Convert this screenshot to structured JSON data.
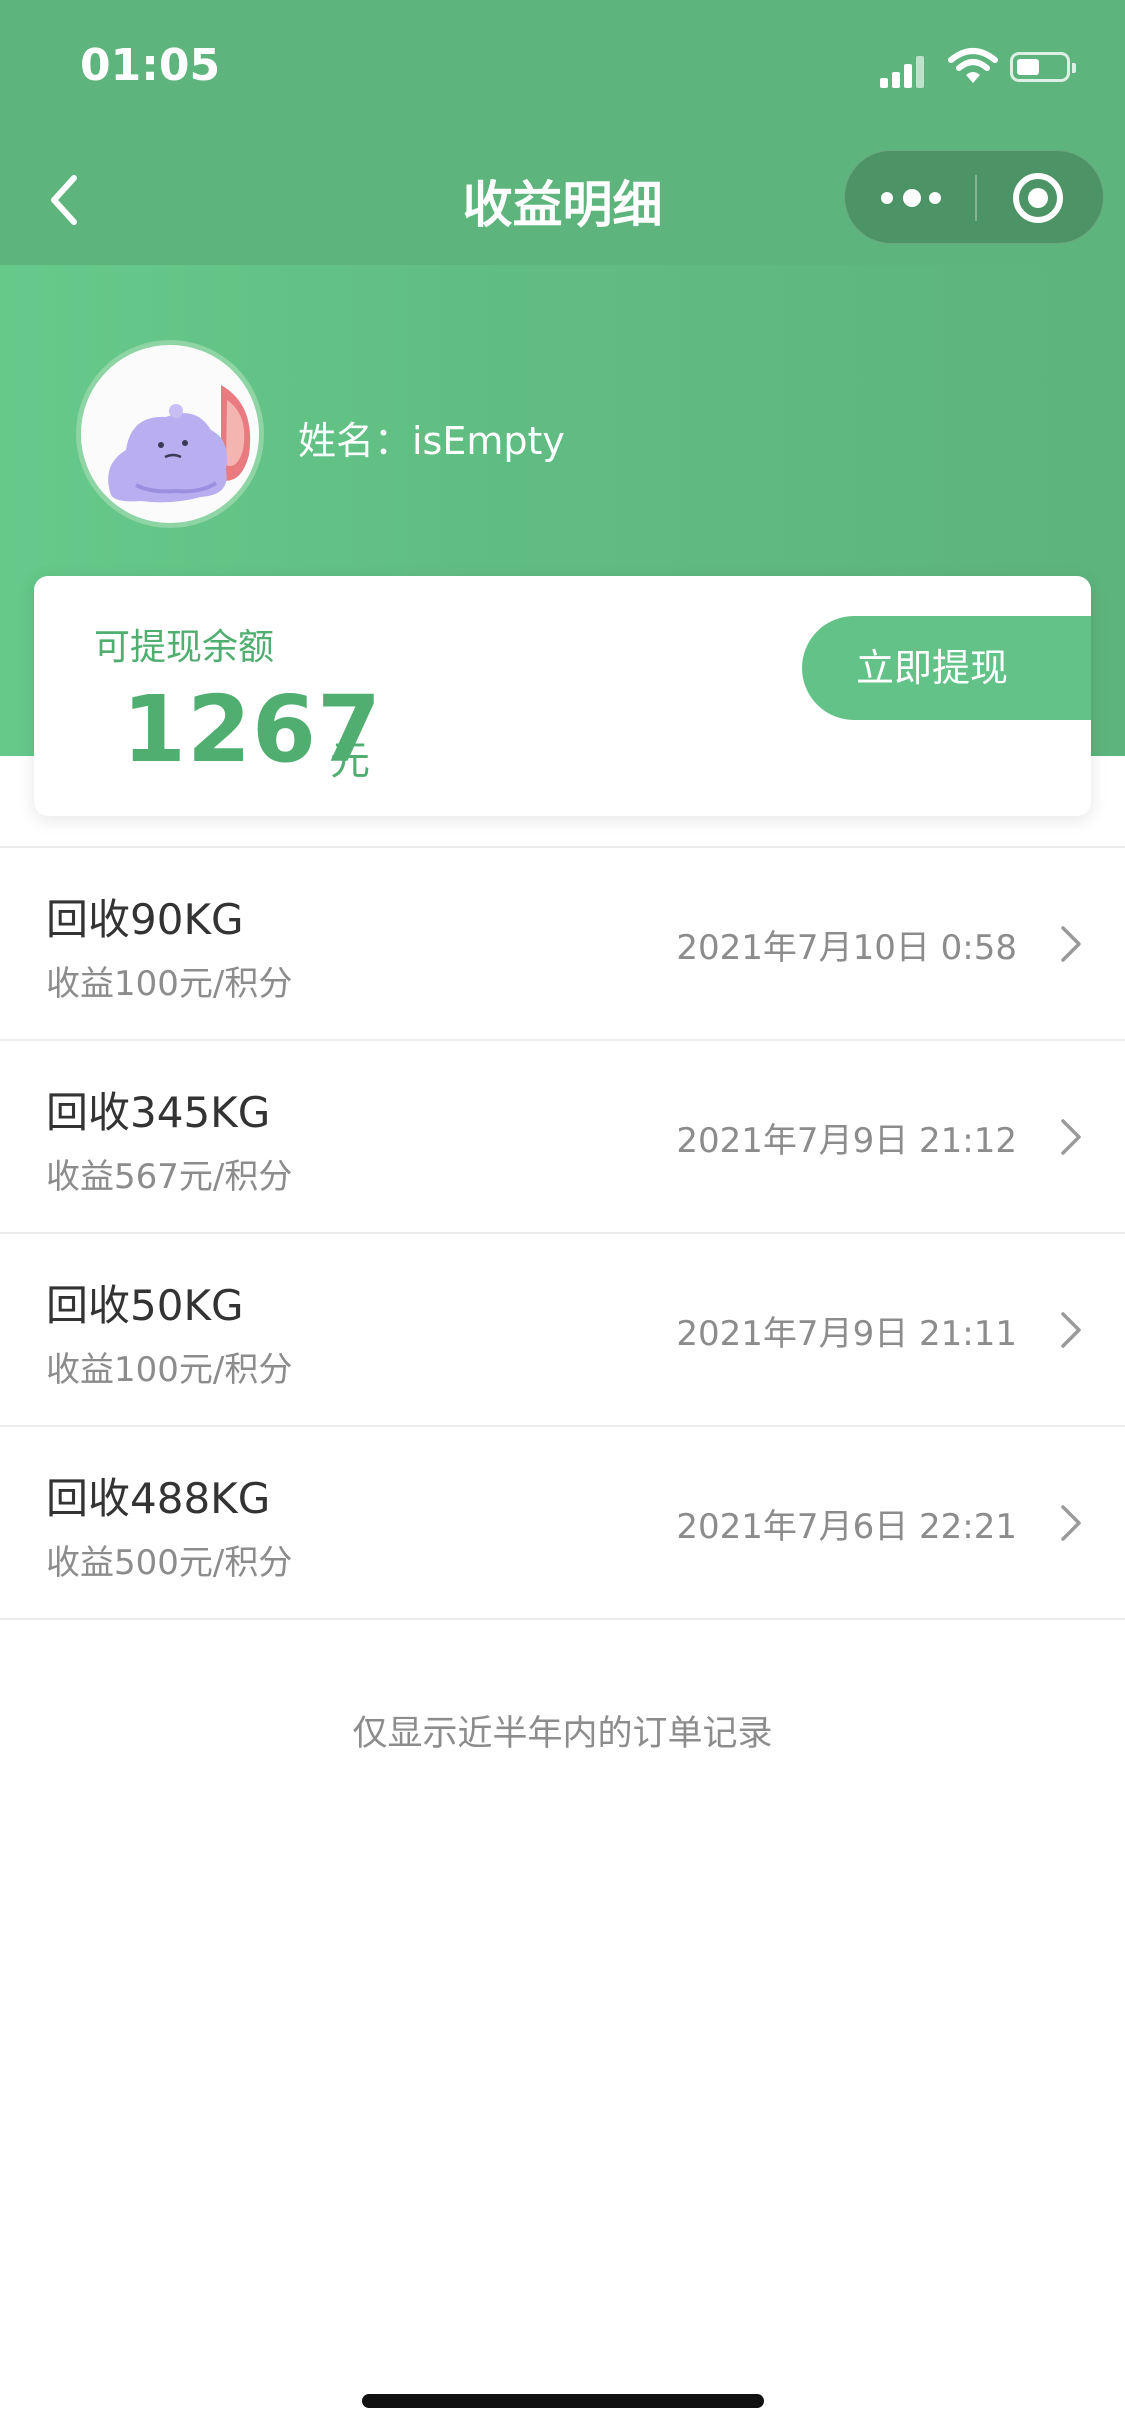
{
  "status_bar": {
    "time": "01:05"
  },
  "nav": {
    "title": "收益明细"
  },
  "profile": {
    "name_label": "姓名：isEmpty"
  },
  "balance": {
    "label": "可提现余额",
    "amount": "1267",
    "unit": "元",
    "button_label": "立即提现"
  },
  "records": [
    {
      "title": "回收90KG",
      "subtitle": "收益100元/积分",
      "time": "2021年7月10日  0:58"
    },
    {
      "title": "回收345KG",
      "subtitle": "收益567元/积分",
      "time": "2021年7月9日  21:12"
    },
    {
      "title": "回收50KG",
      "subtitle": "收益100元/积分",
      "time": "2021年7月9日  21:11"
    },
    {
      "title": "回收488KG",
      "subtitle": "收益500元/积分",
      "time": "2021年7月6日  22:21"
    }
  ],
  "footer": {
    "note": "仅显示近半年内的订单记录"
  },
  "colors": {
    "brand_green": "#5db47c",
    "accent_green": "#4fae70",
    "button_green": "#62c288"
  }
}
